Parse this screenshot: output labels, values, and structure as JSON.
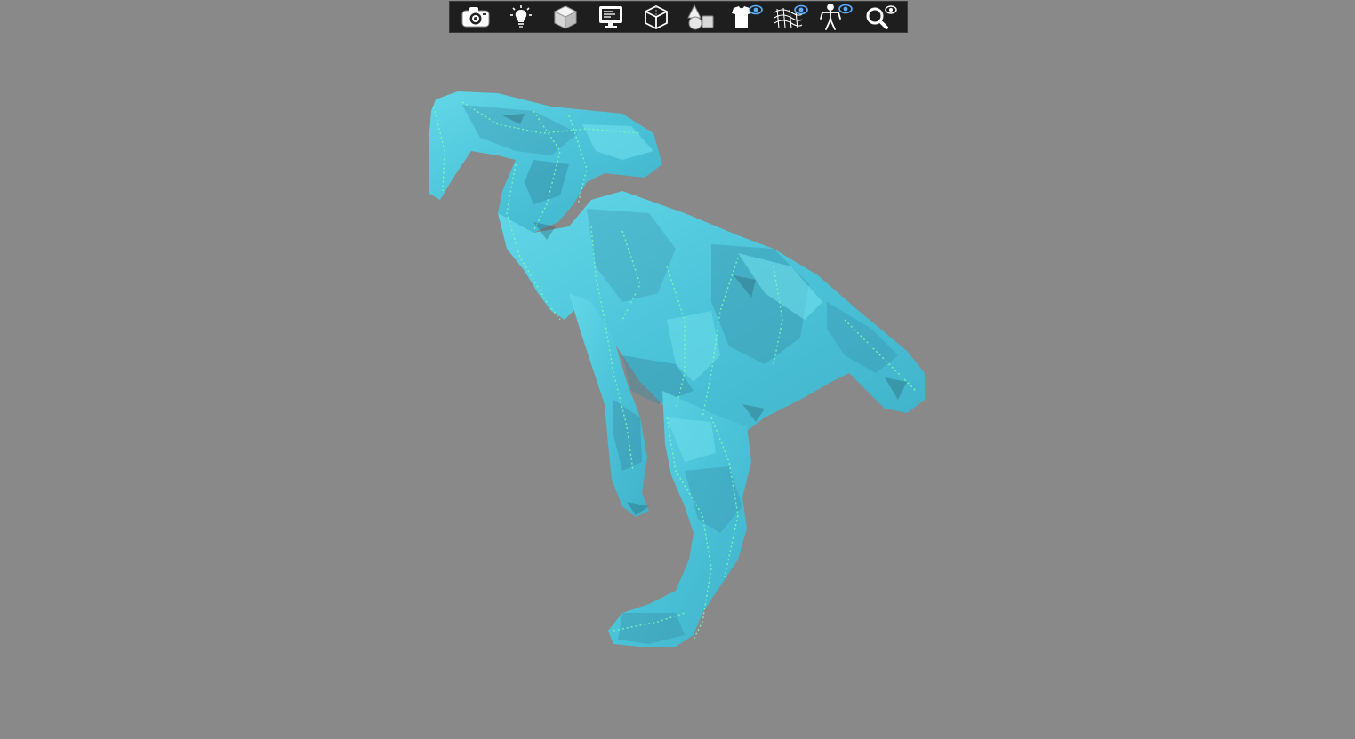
{
  "toolbar": {
    "buttons": [
      {
        "name": "camera-button",
        "icon": "camera-icon"
      },
      {
        "name": "lighting-button",
        "icon": "lightbulb-icon"
      },
      {
        "name": "solid-shading-button",
        "icon": "solid-cube-icon"
      },
      {
        "name": "display-settings-button",
        "icon": "monitor-icon"
      },
      {
        "name": "wireframe-cube-button",
        "icon": "wireframe-cube-icon"
      },
      {
        "name": "primitives-button",
        "icon": "primitive-shapes-icon"
      },
      {
        "name": "texture-visibility-button",
        "icon": "shirt-eye-icon"
      },
      {
        "name": "mesh-visibility-button",
        "icon": "mesh-eye-icon"
      },
      {
        "name": "skeleton-visibility-button",
        "icon": "skeleton-eye-icon"
      },
      {
        "name": "inspect-visibility-button",
        "icon": "magnifier-eye-icon"
      }
    ]
  },
  "viewport": {
    "background_color": "#898989",
    "model_color": "#4fc9dc",
    "model_highlight_color": "#6ee3ee",
    "model_shadow_color": "#3a8fa8",
    "bone_color": "#7dffb5"
  }
}
